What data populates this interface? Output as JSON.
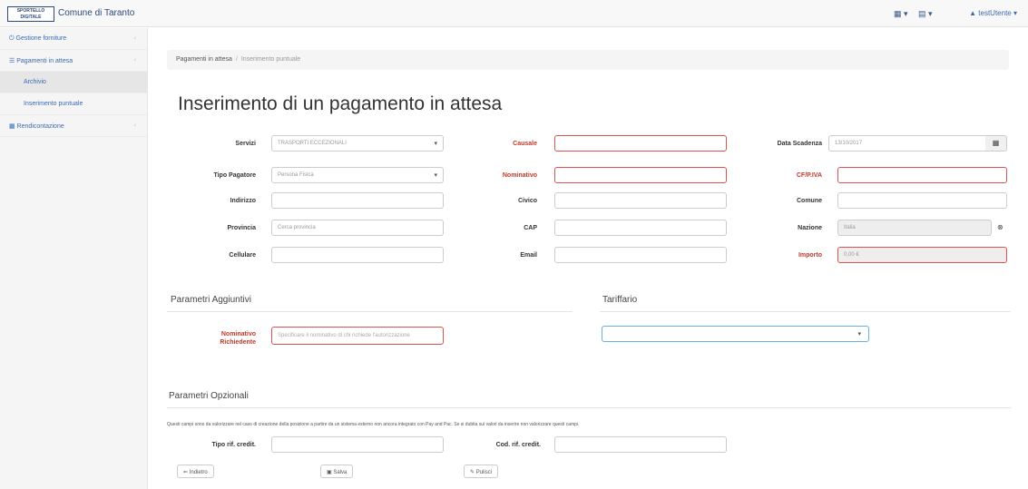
{
  "header": {
    "logo_text": "SPORTELLO DIGITALE",
    "brand": "Comune di Taranto",
    "user": "testUtente"
  },
  "sidebar": {
    "items": [
      {
        "label": "Gestione forniture"
      },
      {
        "label": "Pagamenti in attesa"
      },
      {
        "label": "Archivio"
      },
      {
        "label": "Inserimento puntuale"
      },
      {
        "label": "Rendicontazione"
      }
    ]
  },
  "breadcrumb": {
    "parent": "Pagamenti in attesa",
    "current": "Inserimento puntuale"
  },
  "page": {
    "title": "Inserimento di un pagamento in attesa"
  },
  "form": {
    "servizi_label": "Servizi",
    "servizi_value": "TRASPORTI ECCEZIONALI",
    "causale_label": "Causale",
    "data_scadenza_label": "Data Scadenza",
    "data_scadenza_value": "13/10/2017",
    "tipo_pagatore_label": "Tipo Pagatore",
    "tipo_pagatore_value": "Persona Fisica",
    "nominativo_label": "Nominativo",
    "cf_label": "CF/P.IVA",
    "indirizzo_label": "Indirizzo",
    "civico_label": "Civico",
    "comune_label": "Comune",
    "provincia_label": "Provincia",
    "provincia_placeholder": "Cerca provincia",
    "cap_label": "CAP",
    "nazione_label": "Nazione",
    "nazione_value": "Italia",
    "cellulare_label": "Cellulare",
    "email_label": "Email",
    "importo_label": "Importo",
    "importo_value": "0,00 €"
  },
  "aggiuntivi": {
    "title": "Parametri Aggiuntivi",
    "nominativo_richiedente_label_1": "Nominativo",
    "nominativo_richiedente_label_2": "Richiedente",
    "nominativo_placeholder": "Specificare il nominativo di chi richiede l'autorizzazione"
  },
  "tariffario": {
    "title": "Tariffario"
  },
  "opzionali": {
    "title": "Parametri Opzionali",
    "note": "Questi campi sono da valorizzare nel caso di creazione della posizione a partire da un sistema esterno non ancora integrato con Pay and Pac. Se si dubita sui valori da inserire non valorizzare questi campi.",
    "tipo_label": "Tipo rif. credit.",
    "cod_label": "Cod. rif. credit."
  },
  "buttons": {
    "back": "Indietro",
    "save": "Salva",
    "clear": "Pulisci"
  }
}
